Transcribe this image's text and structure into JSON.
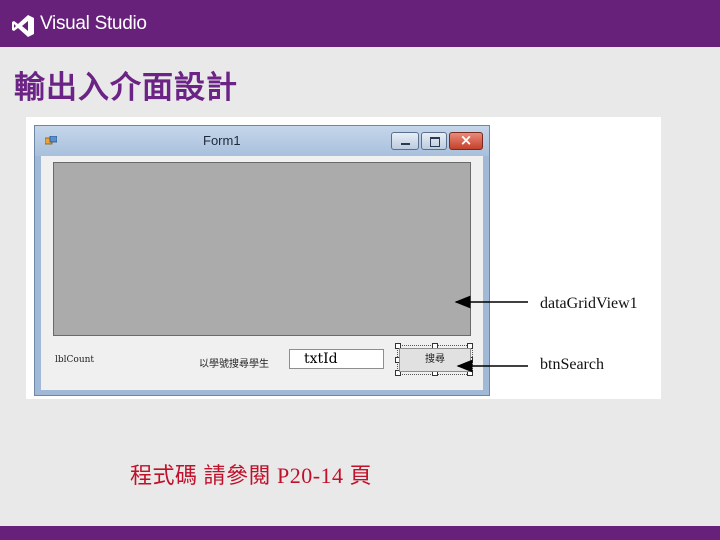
{
  "header": {
    "brand": "Visual Studio",
    "logo_icon": "visual-studio-logo"
  },
  "slide": {
    "title": "輸出入介面設計"
  },
  "form": {
    "title": "Form1",
    "lbl_count": "lblCount",
    "search_label": "以學號搜尋學生",
    "txt_id_value": "txtId",
    "search_button": "搜尋",
    "close_symbol": "×"
  },
  "annotations": {
    "grid": "dataGridView1",
    "button": "btnSearch"
  },
  "note": "程式碼 請參閱  P20-14 頁",
  "colors": {
    "brand_purple": "#68217a",
    "title_purple": "#6b2385",
    "note_red": "#c0102a",
    "grid_gray": "#ababab"
  }
}
